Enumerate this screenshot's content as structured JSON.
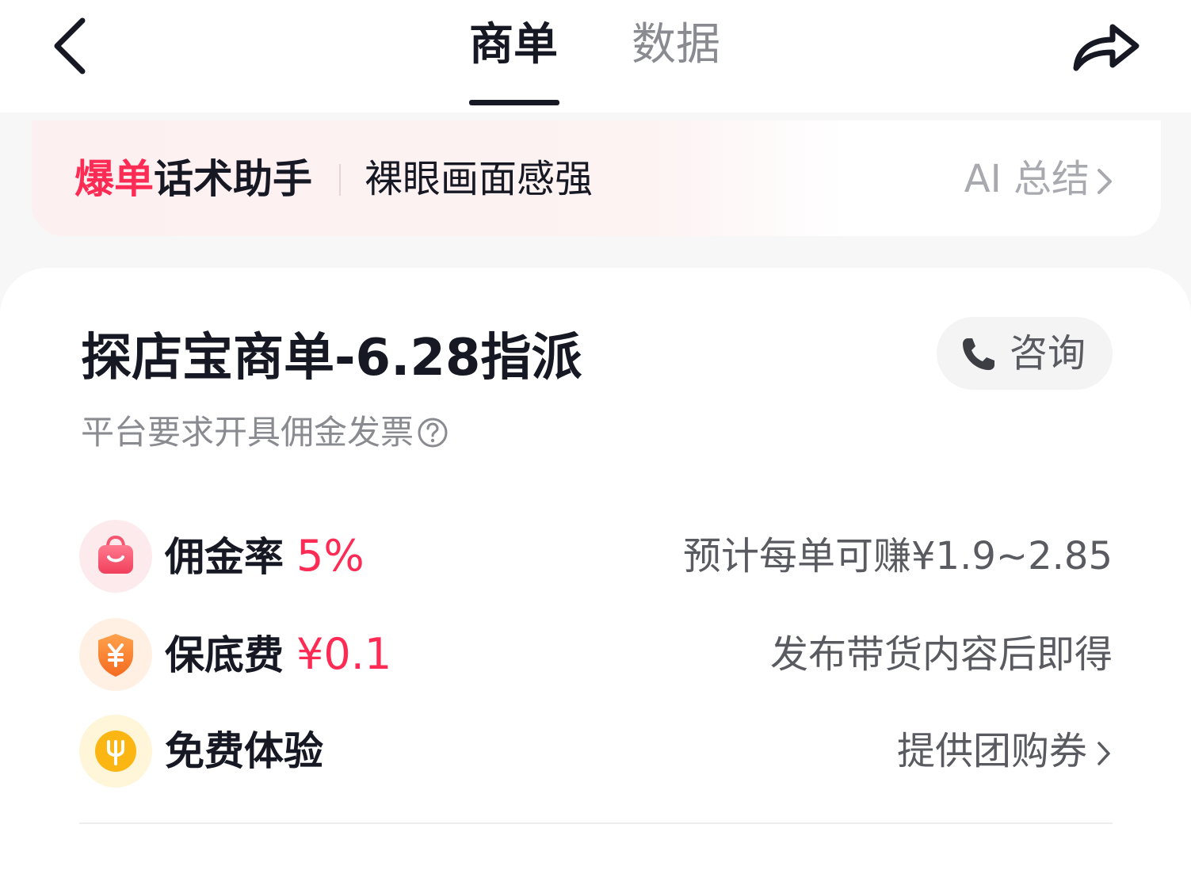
{
  "header": {
    "tabs": [
      {
        "label": "商单",
        "active": true
      },
      {
        "label": "数据",
        "active": false
      }
    ],
    "back_icon": "chevron-left-icon",
    "share_icon": "share-arrow-icon"
  },
  "banner": {
    "title_highlight": "爆单",
    "title_rest": "话术助手",
    "text": "裸眼画面感强",
    "action": "AI 总结"
  },
  "card": {
    "title": "探店宝商单-6.28指派",
    "consult_label": "咨询",
    "subtitle": "平台要求开具佣金发票",
    "rows": [
      {
        "icon": "shopping-bag-icon",
        "label": "佣金率",
        "value": "5%",
        "right_text": "预计每单可赚¥1.9~2.85"
      },
      {
        "icon": "shield-yuan-icon",
        "label": "保底费",
        "value": "¥0.1",
        "right_text": "发布带货内容后即得"
      },
      {
        "icon": "fork-icon",
        "label": "免费体验",
        "value": "",
        "right_text": "提供团购券"
      }
    ]
  },
  "colors": {
    "accent": "#fe2c55",
    "primary_text": "#161823",
    "secondary_text": "#8a8b91",
    "banner_bg": "#fdf0f0"
  }
}
